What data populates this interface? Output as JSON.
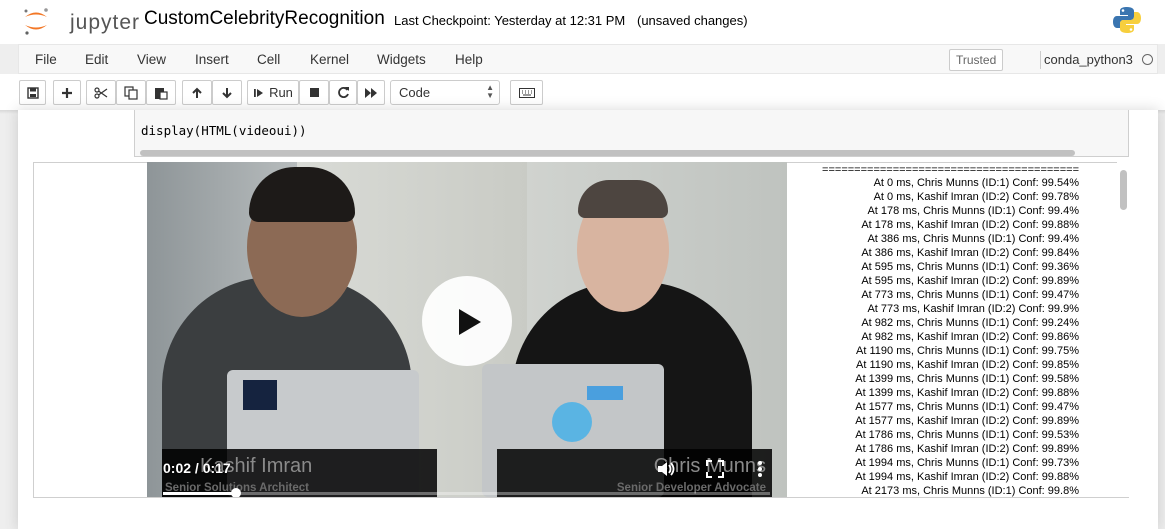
{
  "header": {
    "logo_text": "jupyter",
    "notebook_title": "CustomCelebrityRecognition",
    "checkpoint": "Last Checkpoint: Yesterday at 12:31 PM",
    "unsaved": "(unsaved changes)"
  },
  "menubar": {
    "items": [
      "File",
      "Edit",
      "View",
      "Insert",
      "Cell",
      "Kernel",
      "Widgets",
      "Help"
    ],
    "trusted": "Trusted",
    "kernel": "conda_python3"
  },
  "toolbar": {
    "run_label": "Run",
    "cell_type": "Code"
  },
  "cell": {
    "code": "display(HTML(videoui))"
  },
  "video": {
    "time": "0:02 / 0:17",
    "progress": 0.12,
    "lower_third_1": {
      "name": "Kashif Imran",
      "role": "Senior Solutions Architect"
    },
    "lower_third_2": {
      "name": "Chris Munns",
      "role": "Senior Developer Advocate"
    }
  },
  "log": {
    "separator": "========================================",
    "lines": [
      "At 0 ms, Chris Munns (ID:1) Conf: 99.54%",
      "At 0 ms, Kashif Imran (ID:2) Conf: 99.78%",
      "At 178 ms, Chris Munns (ID:1) Conf: 99.4%",
      "At 178 ms, Kashif Imran (ID:2) Conf: 99.88%",
      "At 386 ms, Chris Munns (ID:1) Conf: 99.4%",
      "At 386 ms, Kashif Imran (ID:2) Conf: 99.84%",
      "At 595 ms, Chris Munns (ID:1) Conf: 99.36%",
      "At 595 ms, Kashif Imran (ID:2) Conf: 99.89%",
      "At 773 ms, Chris Munns (ID:1) Conf: 99.47%",
      "At 773 ms, Kashif Imran (ID:2) Conf: 99.9%",
      "At 982 ms, Chris Munns (ID:1) Conf: 99.24%",
      "At 982 ms, Kashif Imran (ID:2) Conf: 99.86%",
      "At 1190 ms, Chris Munns (ID:1) Conf: 99.75%",
      "At 1190 ms, Kashif Imran (ID:2) Conf: 99.85%",
      "At 1399 ms, Chris Munns (ID:1) Conf: 99.58%",
      "At 1399 ms, Kashif Imran (ID:2) Conf: 99.88%",
      "At 1577 ms, Chris Munns (ID:1) Conf: 99.47%",
      "At 1577 ms, Kashif Imran (ID:2) Conf: 99.89%",
      "At 1786 ms, Chris Munns (ID:1) Conf: 99.53%",
      "At 1786 ms, Kashif Imran (ID:2) Conf: 99.89%",
      "At 1994 ms, Chris Munns (ID:1) Conf: 99.73%",
      "At 1994 ms, Kashif Imran (ID:2) Conf: 99.88%",
      "At 2173 ms, Chris Munns (ID:1) Conf: 99.8%"
    ]
  },
  "colors": {
    "jupyter_orange": "#f37726",
    "notebook_bg": "#eeeeee"
  }
}
